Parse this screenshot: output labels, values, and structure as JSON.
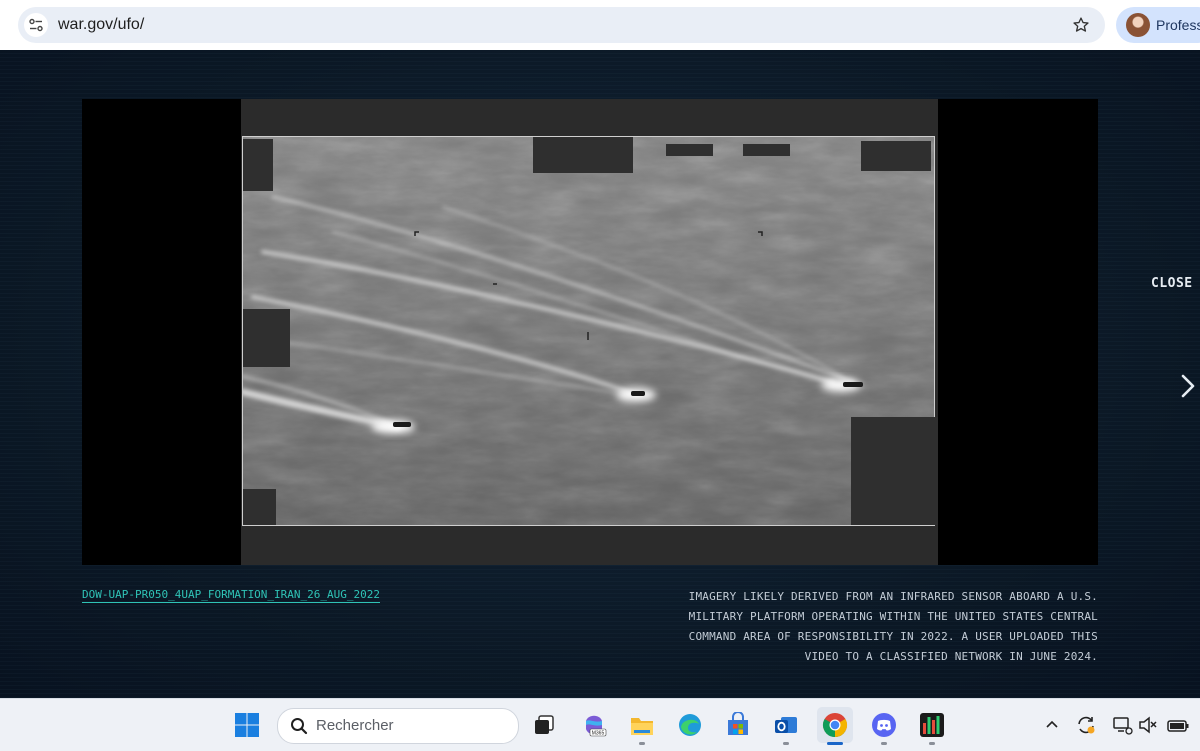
{
  "browser": {
    "url": "war.gov/ufo/",
    "profile_label": "Professi",
    "icons": [
      "site-info-icon",
      "bookmark-star-icon",
      "profile-avatar"
    ]
  },
  "viewer": {
    "close_label": "CLOSE",
    "next_icon": "chevron-right-icon",
    "video_id": "DOW-UAP-PR050_4UAP_FORMATION_IRAN_26_AUG_2022",
    "description_lines": [
      "IMAGERY LIKELY DERIVED FROM AN INFRARED SENSOR ABOARD A U.S.",
      "MILITARY PLATFORM OPERATING WITHIN THE UNITED STATES CENTRAL",
      "COMMAND AREA OF RESPONSIBILITY IN 2022. A USER UPLOADED THIS",
      "VIDEO TO A CLASSIFIED NETWORK IN JUNE 2024."
    ]
  },
  "taskbar": {
    "search_placeholder": "Rechercher",
    "apps": [
      "windows-start-icon",
      "task-view-icon",
      "microsoft-365-icon",
      "file-explorer-icon",
      "edge-icon",
      "microsoft-store-icon",
      "outlook-icon",
      "chrome-icon",
      "discord-icon",
      "app-monitor-icon"
    ],
    "tray": [
      "show-hidden-icons-chevron",
      "sync-icon",
      "network-icon",
      "volume-muted-icon",
      "battery-icon"
    ]
  },
  "colors": {
    "page_background": "#0b1825",
    "link_accent": "#2fc3b6",
    "omnibox": "#e9eef6",
    "profile_chip": "#d3e3fd"
  }
}
